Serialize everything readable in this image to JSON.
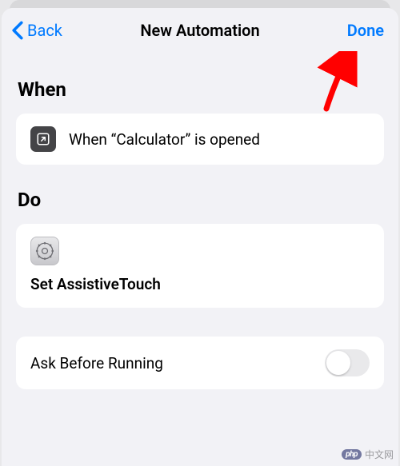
{
  "nav": {
    "back_label": "Back",
    "title": "New Automation",
    "done_label": "Done"
  },
  "sections": {
    "when": {
      "header": "When",
      "condition_text": "When “Calculator” is opened"
    },
    "do": {
      "header": "Do",
      "action_title": "Set AssistiveTouch"
    }
  },
  "settings": {
    "ask_before_running_label": "Ask Before Running",
    "ask_before_running_value": false
  },
  "watermark": {
    "logo": "php",
    "text": "中文网"
  }
}
